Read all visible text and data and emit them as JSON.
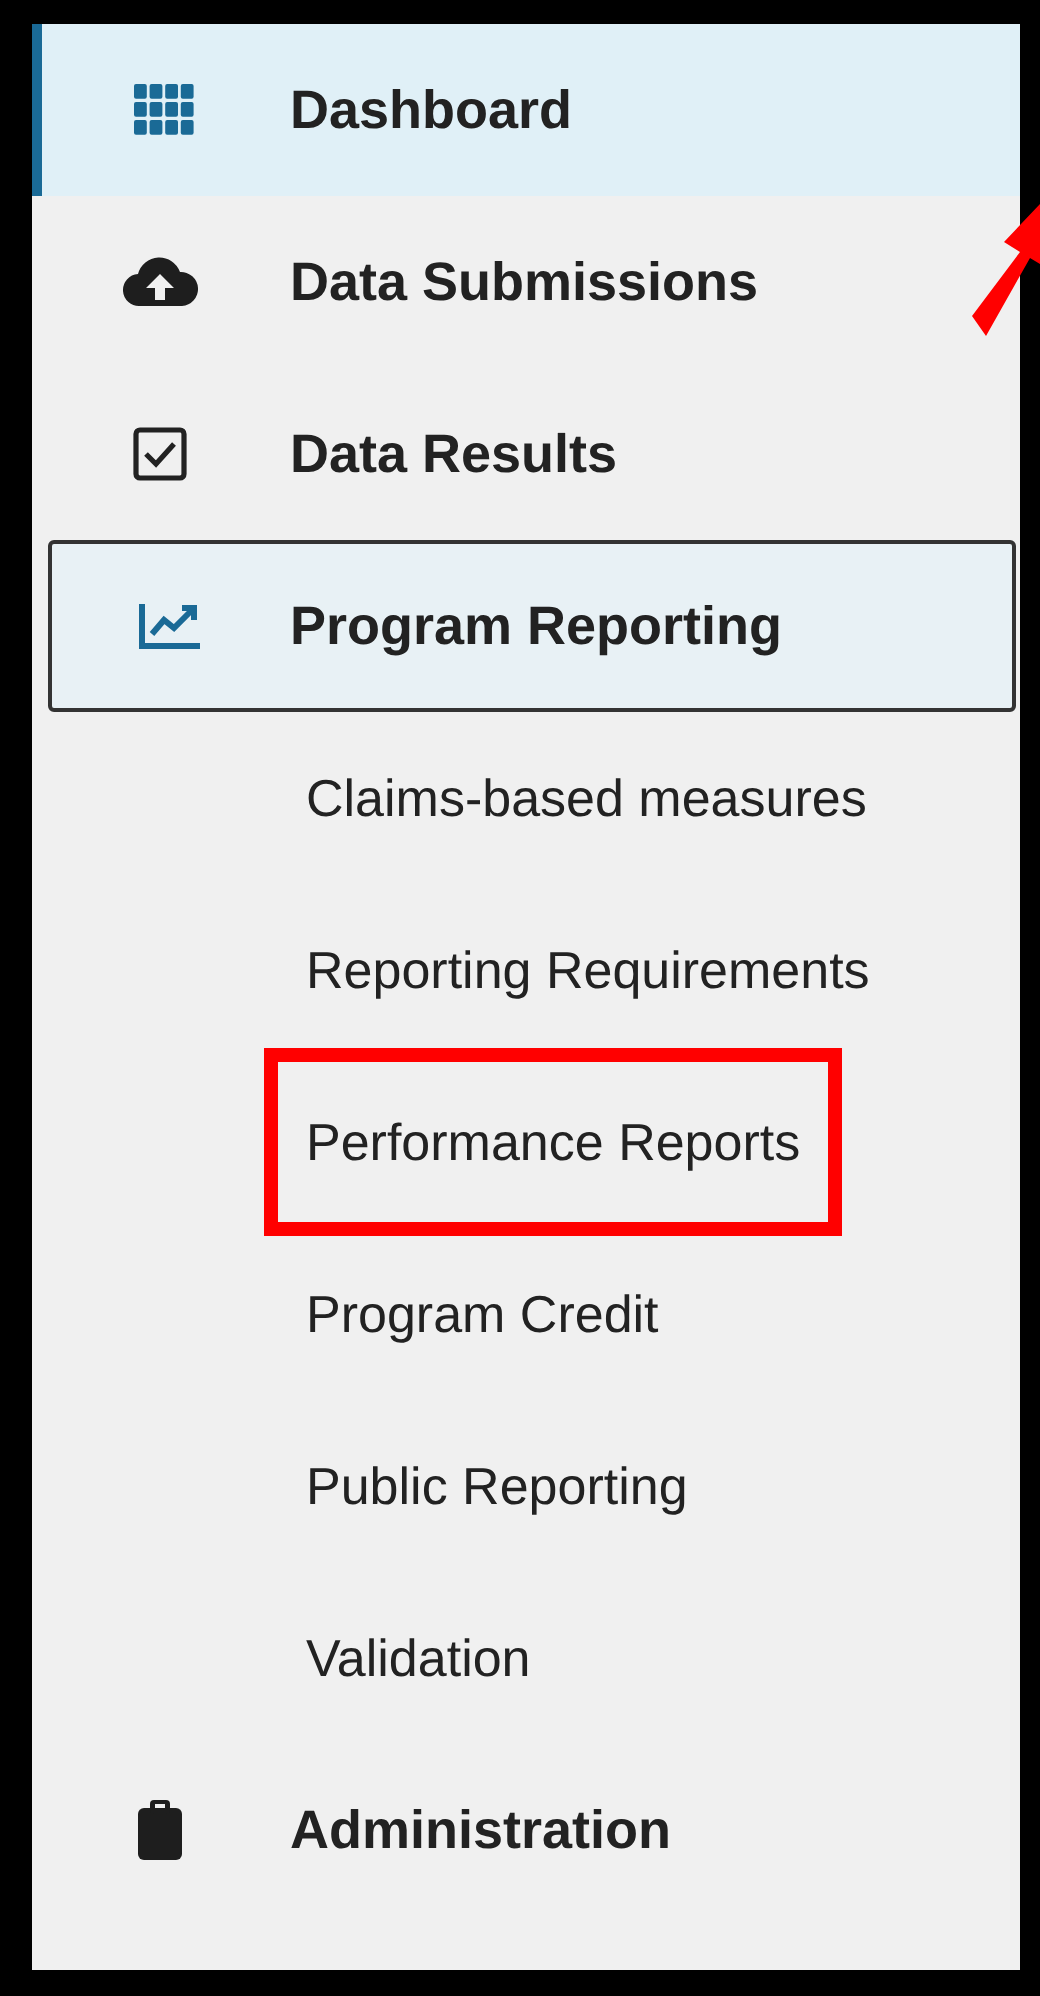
{
  "nav": [
    {
      "label": "Dashboard",
      "selected": true,
      "expanded": false
    },
    {
      "label": "Data Submissions",
      "selected": false,
      "expanded": false
    },
    {
      "label": "Data Results",
      "selected": false,
      "expanded": false
    },
    {
      "label": "Program Reporting",
      "selected": false,
      "expanded": true,
      "children": [
        {
          "label": "Claims-based measures",
          "highlighted": false
        },
        {
          "label": "Reporting Requirements",
          "highlighted": false
        },
        {
          "label": "Performance Reports",
          "highlighted": true
        },
        {
          "label": "Program Credit",
          "highlighted": false
        },
        {
          "label": "Public Reporting",
          "highlighted": false
        },
        {
          "label": "Validation",
          "highlighted": false
        }
      ]
    },
    {
      "label": "Administration",
      "selected": false,
      "expanded": false
    }
  ]
}
